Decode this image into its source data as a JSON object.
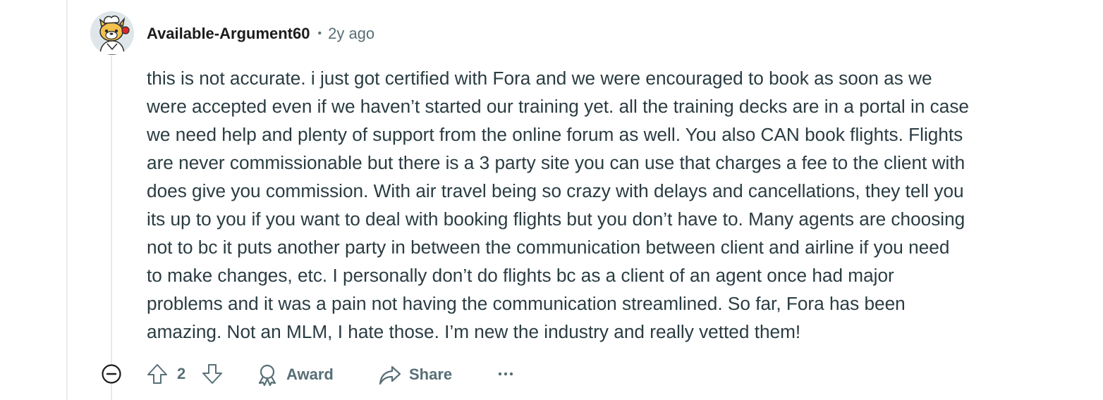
{
  "comment": {
    "author": "Available-Argument60",
    "separator": "•",
    "age": "2y ago",
    "avatar_icon": "snoo-avatar-icon",
    "body_lines": [
      "this is not accurate. i just got certified with Fora and we were encouraged to book as soon as we",
      "were accepted even if we haven’t started our training yet. all the training decks are in a portal in case",
      "we need help and plenty of support from the online forum as well. You also CAN book flights. Flights",
      "are never commissionable but there is a 3 party site you can use that charges a fee to the client with",
      "does give you commission. With air travel being so crazy with delays and cancellations, they tell you",
      "its up to you if you want to deal with booking flights but you don’t have to. Many agents are choosing",
      "not to bc it puts another party in between the communication between client and airline if you need",
      "to make changes, etc. I personally don’t do flights bc as a client of an agent once had major",
      "problems and it was a pain not having the communication streamlined. So far, Fora has been",
      "amazing. Not an MLM, I hate those. I’m new the industry and really vetted them!"
    ]
  },
  "actions": {
    "collapse_icon": "collapse-icon",
    "upvote_icon": "upvote-icon",
    "score": "2",
    "downvote_icon": "downvote-icon",
    "award_icon": "award-icon",
    "award_label": "Award",
    "share_icon": "share-icon",
    "share_label": "Share",
    "more_icon": "more-options-icon"
  },
  "colors": {
    "text_primary": "#1c1c1c",
    "text_body": "#2a3c42",
    "text_secondary": "#576f76",
    "thread_line": "#e5ebee",
    "background": "#ffffff"
  }
}
